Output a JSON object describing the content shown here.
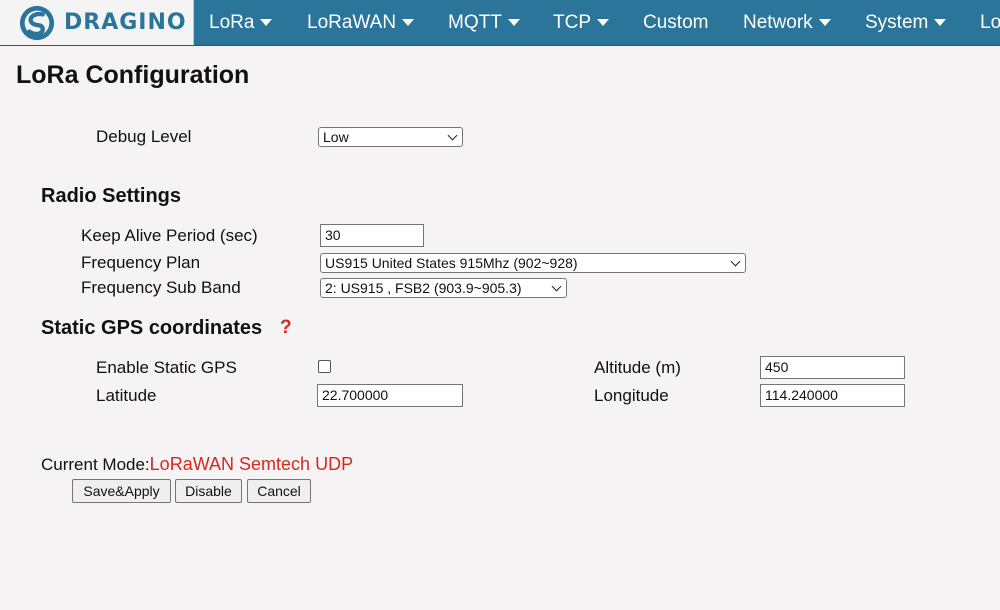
{
  "brand": {
    "name": "DRAGINO"
  },
  "nav": {
    "items": [
      {
        "label": "LoRa",
        "has_caret": true
      },
      {
        "label": "LoRaWAN",
        "has_caret": true
      },
      {
        "label": "MQTT",
        "has_caret": true
      },
      {
        "label": "TCP",
        "has_caret": true
      },
      {
        "label": "Custom",
        "has_caret": false
      },
      {
        "label": "Network",
        "has_caret": true
      },
      {
        "label": "System",
        "has_caret": true
      },
      {
        "label": "Lo",
        "has_caret": false
      }
    ]
  },
  "page": {
    "title": "LoRa Configuration"
  },
  "debug": {
    "label": "Debug Level",
    "value": "Low"
  },
  "radio": {
    "title": "Radio Settings",
    "keep_alive_label": "Keep Alive Period (sec)",
    "keep_alive_value": "30",
    "freq_plan_label": "Frequency Plan",
    "freq_plan_value": "US915 United States 915Mhz (902~928)",
    "sub_band_label": "Frequency Sub Band",
    "sub_band_value": "2: US915 , FSB2 (903.9~905.3)"
  },
  "gps": {
    "title": "Static GPS coordinates",
    "help": "?",
    "enable_label": "Enable Static GPS",
    "enabled": false,
    "latitude_label": "Latitude",
    "latitude_value": "22.700000",
    "altitude_label": "Altitude (m)",
    "altitude_value": "450",
    "longitude_label": "Longitude",
    "longitude_value": "114.240000"
  },
  "mode": {
    "label": "Current Mode:",
    "value": "LoRaWAN Semtech UDP"
  },
  "buttons": {
    "save": "Save&Apply",
    "disable": "Disable",
    "cancel": "Cancel"
  },
  "colors": {
    "nav_bg": "#2a7599",
    "accent_red": "#d42a1f",
    "page_bg": "#f5f3f4"
  }
}
